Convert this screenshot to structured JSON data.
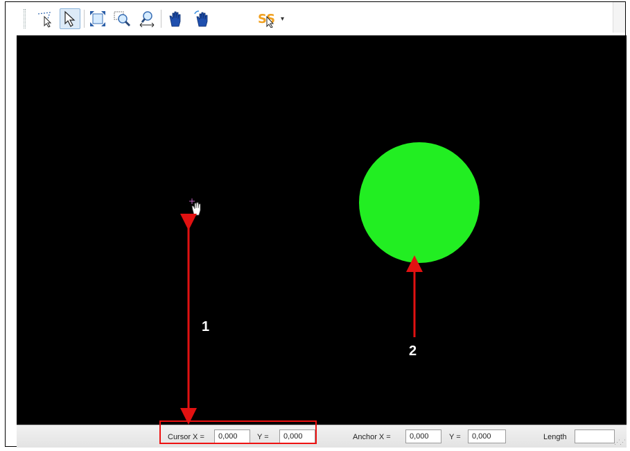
{
  "toolbar": {
    "tools": [
      {
        "name": "lasso-select",
        "active": false
      },
      {
        "name": "pointer-select",
        "active": true
      },
      {
        "name": "zoom-extents",
        "active": false
      },
      {
        "name": "zoom-window",
        "active": false
      },
      {
        "name": "zoom-horizontal",
        "active": false
      },
      {
        "name": "pan-hand",
        "active": false
      },
      {
        "name": "pan-rotate-hand",
        "active": false
      },
      {
        "name": "snap-tool",
        "active": false
      }
    ]
  },
  "canvas": {
    "background": "#000000",
    "shape_color": "#22ee22"
  },
  "annotations": {
    "label_1": "1",
    "label_2": "2",
    "arrow_color": "#e11111"
  },
  "statusbar": {
    "cursor_x_label": "Cursor X =",
    "cursor_x_value": "0,000",
    "cursor_y_label": "Y =",
    "cursor_y_value": "0,000",
    "anchor_x_label": "Anchor X =",
    "anchor_x_value": "0,000",
    "anchor_y_label": "Y =",
    "anchor_y_value": "0,000",
    "length_label": "Length",
    "length_value": ""
  }
}
